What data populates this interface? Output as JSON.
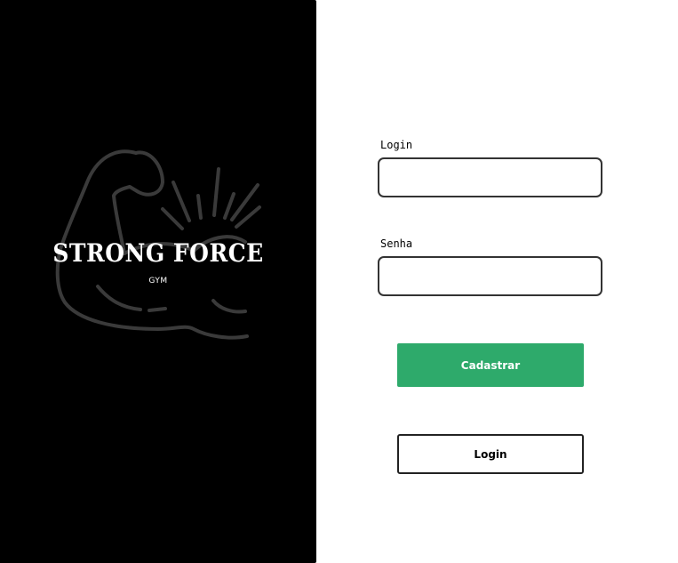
{
  "brand": {
    "name": "STRONG FORCE",
    "subtitle": "GYM"
  },
  "form": {
    "login_label": "Login",
    "login_value": "",
    "password_label": "Senha",
    "password_value": ""
  },
  "buttons": {
    "register_label": "Cadastrar",
    "login_label": "Login"
  },
  "colors": {
    "left_panel_bg": "#000000",
    "logo_stroke": "#3a3a3a",
    "primary_button": "#2eaa6b",
    "page_bg": "#ffffff"
  },
  "icons": {
    "logo": "flexed-arm-icon"
  }
}
